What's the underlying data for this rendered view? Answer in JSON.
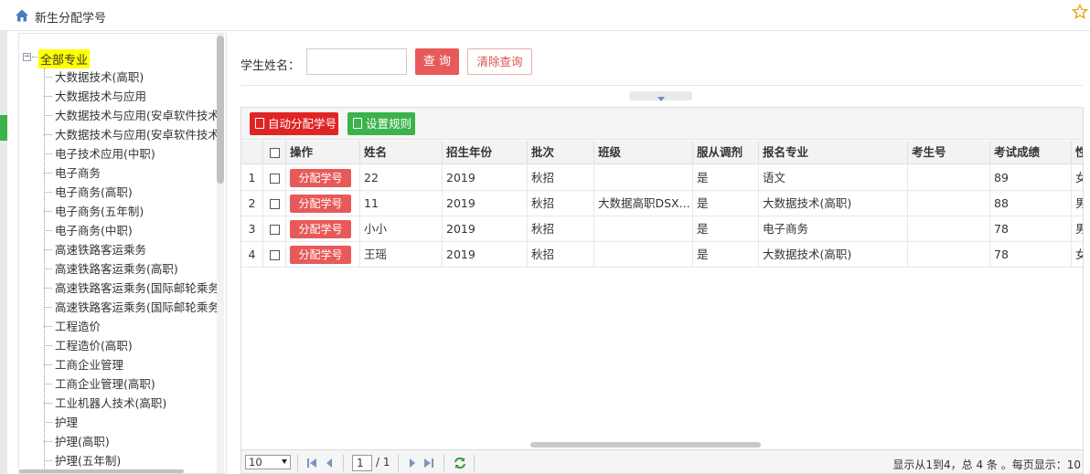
{
  "header": {
    "title": "新生分配学号",
    "home_icon": "home-icon",
    "star_icon": "star-icon"
  },
  "tree": {
    "root": "全部专业",
    "items": [
      "大数据技术(高职)",
      "大数据技术与应用",
      "大数据技术与应用(安卓软件技术",
      "大数据技术与应用(安卓软件技术",
      "电子技术应用(中职)",
      "电子商务",
      "电子商务(高职)",
      "电子商务(五年制)",
      "电子商务(中职)",
      "高速铁路客运乘务",
      "高速铁路客运乘务(高职)",
      "高速铁路客运乘务(国际邮轮乘务",
      "高速铁路客运乘务(国际邮轮乘务",
      "工程造价",
      "工程造价(高职)",
      "工商企业管理",
      "工商企业管理(高职)",
      "工业机器人技术(高职)",
      "护理",
      "护理(高职)",
      "护理(五年制)"
    ]
  },
  "search": {
    "label": "学生姓名：",
    "value": "",
    "query_button": "查 询",
    "clear_button": "清除查询"
  },
  "toolbar": {
    "auto_assign": "自动分配学号",
    "set_rules": "设置规则"
  },
  "table": {
    "columns": [
      "操作",
      "姓名",
      "招生年份",
      "批次",
      "班级",
      "服从调剂",
      "报名专业",
      "考生号",
      "考试成绩",
      "性"
    ],
    "assign_label": "分配学号",
    "rows": [
      {
        "num": "1",
        "name": "22",
        "year": "2019",
        "batch": "秋招",
        "class": "",
        "adjust": "是",
        "major": "语文",
        "exam_no": "",
        "score": "89",
        "sex": "女"
      },
      {
        "num": "2",
        "name": "11",
        "year": "2019",
        "batch": "秋招",
        "class": "大数据高职DSX...",
        "adjust": "是",
        "major": "大数据技术(高职)",
        "exam_no": "",
        "score": "88",
        "sex": "男"
      },
      {
        "num": "3",
        "name": "小小",
        "year": "2019",
        "batch": "秋招",
        "class": "",
        "adjust": "是",
        "major": "电子商务",
        "exam_no": "",
        "score": "78",
        "sex": "男"
      },
      {
        "num": "4",
        "name": "王瑶",
        "year": "2019",
        "batch": "秋招",
        "class": "",
        "adjust": "是",
        "major": "大数据技术(高职)",
        "exam_no": "",
        "score": "78",
        "sex": "女"
      }
    ]
  },
  "pager": {
    "page_size": "10",
    "page": "1",
    "total_pages": "/ 1",
    "info": "显示从1到4，总 4 条 。每页显示：10"
  },
  "colors": {
    "accent_red": "#e85a5a",
    "auto_red": "#e02424",
    "green": "#3bb34a",
    "highlight": "#ffff00"
  }
}
